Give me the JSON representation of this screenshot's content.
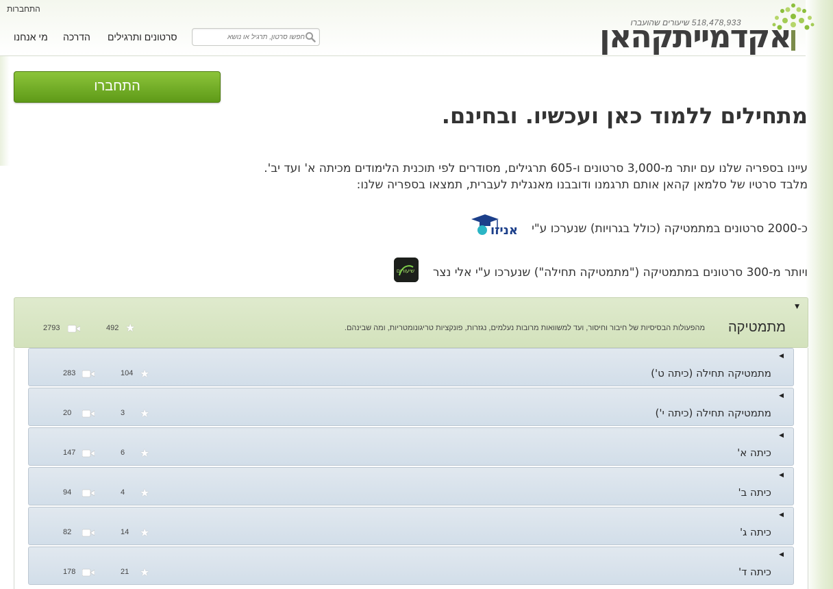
{
  "header": {
    "login_link": "התחברות",
    "nav": {
      "about": "מי אנחנו",
      "guide": "הדרכה",
      "videos": "סרטונים ותרגילים"
    },
    "search_placeholder": "חפשו סרטון, תרגיל או נושא",
    "lessons_count": "518,478,933",
    "lessons_label": "שיעורים שהועברו",
    "logo_text": "אקדמייתקהאן"
  },
  "hero": {
    "join_button": "התחברו",
    "title": "מתחילים ללמוד כאן ועכשיו. ובחינם.",
    "line1": "עיינו בספריה שלנו עם יותר מ-3,000 סרטונים ו-605 תרגילים, מסודרים לפי תוכנית הלימודים מכיתה א' ועד יב'.",
    "line2": "מלבד סרטיו של סלמאן קהאן אותם תרגמנו ודובבנו מאנגלית לעברית, תמצאו בספריה שלנו:",
    "line3": "כ-2000 סרטונים במתמטיקה (כולל בגרויות) שנערכו ע\"י",
    "line4": "ויותר מ-300 סרטונים במתמטיקה (\"מתמטיקה תחילה\") שנערכו ע\"י אלי נצר",
    "aneo_logo_text": "אניזו",
    "eli_logo_text": "שיעורים"
  },
  "topic": {
    "title": "מתמטיקה",
    "description": "מהפעולות הבסיסיות של חיבור וחיסור, ועד למשוואות מרובות נעלמים, נגזרות, פונקציות טריגונומטריות, ומה שבינהם.",
    "exercises": "492",
    "videos": "2793"
  },
  "subtopics": [
    {
      "title": "מתמטיקה תחילה (כיתה ט')",
      "exercises": "104",
      "videos": "283"
    },
    {
      "title": "מתמטיקה תחילה (כיתה י')",
      "exercises": "3",
      "videos": "20"
    },
    {
      "title": "כיתה א'",
      "exercises": "6",
      "videos": "147"
    },
    {
      "title": "כיתה ב'",
      "exercises": "4",
      "videos": "94"
    },
    {
      "title": "כיתה ג'",
      "exercises": "14",
      "videos": "82"
    },
    {
      "title": "כיתה ד'",
      "exercises": "21",
      "videos": "178"
    }
  ],
  "icons": {
    "search": "search-icon",
    "exercise": "star-icon",
    "video": "video-camera-icon",
    "expand": "triangle-down-icon",
    "collapsed": "triangle-left-icon"
  },
  "colors": {
    "join_button": "#6fae24",
    "topic_bg": "#d9e6c5",
    "subtopic_bg": "#d8e2ec"
  }
}
